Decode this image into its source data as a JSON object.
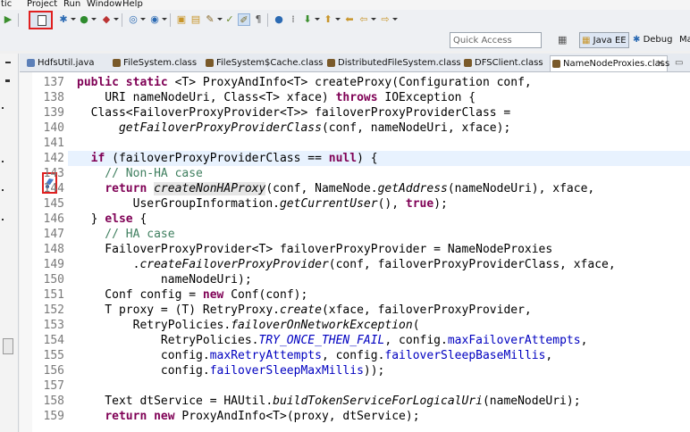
{
  "menu": {
    "items": [
      "tic",
      "Project",
      "Run",
      "Window",
      "Help"
    ]
  },
  "toolbar": {
    "highlighted_button": "toggle-breakpoint-button",
    "highlight_color": "#e02020"
  },
  "quick_access": {
    "placeholder": "Quick Access"
  },
  "perspectives": {
    "java_ee": "Java EE",
    "debug": "Debug",
    "more": "Ma"
  },
  "tabs": [
    {
      "label": "HdfsUtil.java"
    },
    {
      "label": "FileSystem.class"
    },
    {
      "label": "FileSystem$Cache.class"
    },
    {
      "label": "DistributedFileSystem.class"
    },
    {
      "label": "DFSClient.class"
    },
    {
      "label": "NameNodeProxies.class",
      "active": true,
      "close": "✕"
    }
  ],
  "editor": {
    "line_numbers": [
      "137",
      "138",
      "139",
      "140",
      "141",
      "142",
      "143",
      "144",
      "145",
      "146",
      "147",
      "148",
      "149",
      "150",
      "151",
      "152",
      "153",
      "154",
      "155",
      "156",
      "157",
      "158",
      "159"
    ],
    "highlighted_line": "142",
    "colors": {
      "keyword": "#7f0055",
      "comment": "#3f7f5f",
      "field": "#0000c0",
      "current_line": "#e8f2fe"
    },
    "code": {
      "l137a": "public static ",
      "l137b": "<T> ProxyAndInfo<T> createProxy(Configuration conf,",
      "l138a": "    URI nameNodeUri, Class<T> xface) ",
      "l138b": "throws",
      "l138c": " IOException {",
      "l139": "  Class<FailoverProxyProvider<T>> failoverProxyProviderClass =",
      "l140a": "      ",
      "l140b": "getFailoverProxyProviderClass",
      "l140c": "(conf, nameNodeUri, xface);",
      "l142a": "  ",
      "l142b": "if",
      "l142c": " (failoverProxyProviderClass == ",
      "l142d": "null",
      "l142e": ") {",
      "l143": "    // Non-HA case",
      "l144a": "    ",
      "l144b": "return",
      "l144c": " ",
      "l144d": "createNonHAProxy",
      "l144e": "(conf, NameNode.",
      "l144f": "getAddress",
      "l144g": "(nameNodeUri), xface,",
      "l145a": "        UserGroupInformation.",
      "l145b": "getCurrentUser",
      "l145c": "(), ",
      "l145d": "true",
      "l145e": ");",
      "l146a": "  } ",
      "l146b": "else",
      "l146c": " {",
      "l147": "    // HA case",
      "l148": "    FailoverProxyProvider<T> failoverProxyProvider = NameNodeProxies",
      "l149a": "        .",
      "l149b": "createFailoverProxyProvider",
      "l149c": "(conf, failoverProxyProviderClass, xface,",
      "l150": "            nameNodeUri);",
      "l151a": "    Conf config = ",
      "l151b": "new",
      "l151c": " Conf(conf);",
      "l152a": "    T proxy = (T) RetryProxy.",
      "l152b": "create",
      "l152c": "(xface, failoverProxyProvider,",
      "l153a": "        RetryPolicies.",
      "l153b": "failoverOnNetworkException",
      "l153c": "(",
      "l154a": "            RetryPolicies.",
      "l154b": "TRY_ONCE_THEN_FAIL",
      "l154c": ", config.",
      "l154d": "maxFailoverAttempts",
      "l154e": ",",
      "l155a": "            config.",
      "l155b": "maxRetryAttempts",
      "l155c": ", config.",
      "l155d": "failoverSleepBaseMillis",
      "l155e": ",",
      "l156a": "            config.",
      "l156b": "failoverSleepMaxMillis",
      "l156c": "));",
      "l158a": "    Text dtService = HAUtil.",
      "l158b": "buildTokenServiceForLogicalUri",
      "l158c": "(nameNodeUri);",
      "l159a": "    ",
      "l159b": "return",
      "l159c": " ",
      "l159d": "new",
      "l159e": " ProxyAndInfo<T>(proxy, dtService);"
    }
  }
}
